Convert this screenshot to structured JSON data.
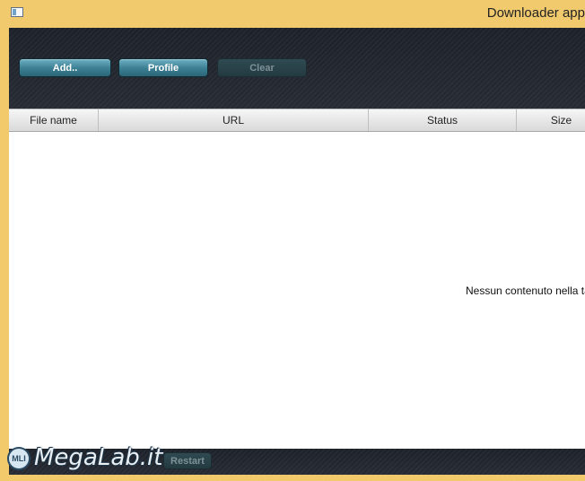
{
  "window": {
    "title": "Downloader app",
    "icon": "app-window-icon"
  },
  "toolbar": {
    "add_label": "Add..",
    "profile_label": "Profile",
    "clear_label": "Clear"
  },
  "table": {
    "columns": [
      "File name",
      "URL",
      "Status",
      "Size"
    ],
    "empty_message": "Nessun contenuto nella tabella"
  },
  "footer": {
    "restart_label": "Restart"
  },
  "watermark": {
    "logo_text": "MLI",
    "text": "MegaLab.it"
  },
  "colors": {
    "window_frame": "#f2c96b",
    "toolbar_bg": "#22262e",
    "button_active": "#3b7e92",
    "button_disabled": "#2f4a52"
  }
}
